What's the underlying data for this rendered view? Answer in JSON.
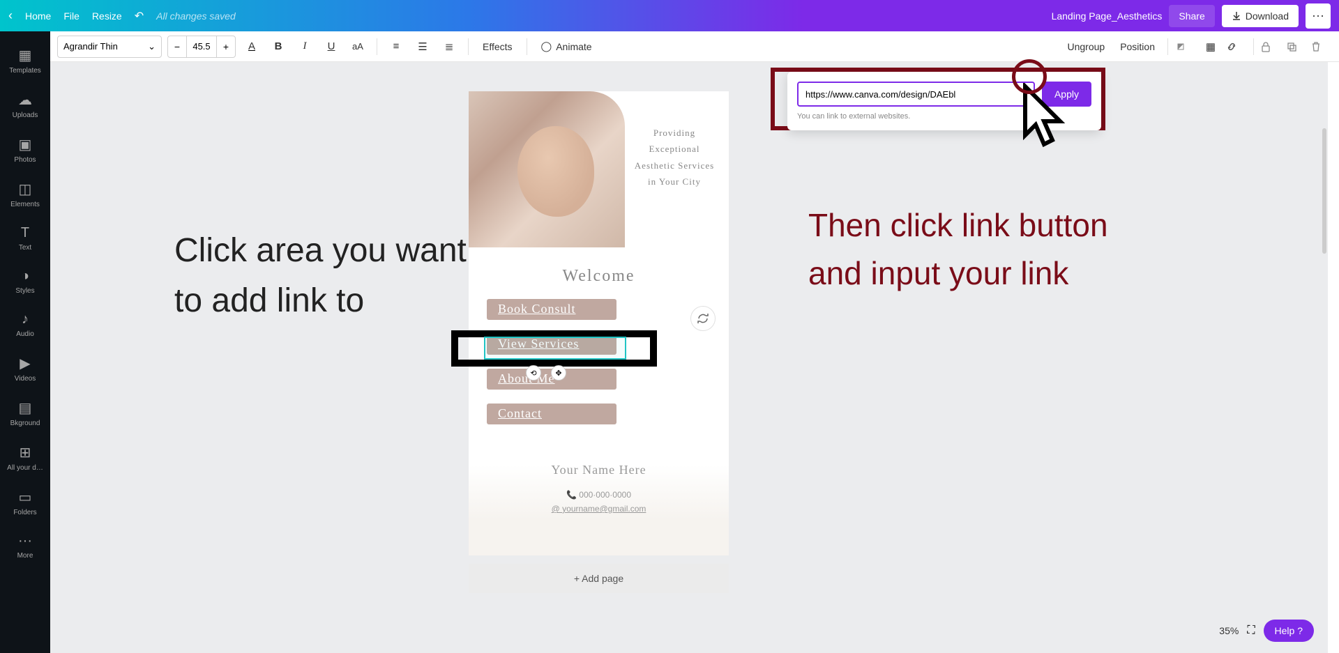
{
  "topbar": {
    "home": "Home",
    "file": "File",
    "resize": "Resize",
    "saved": "All changes saved",
    "docname": "Landing Page_Aesthetics",
    "share": "Share",
    "download": "Download"
  },
  "sidebar": {
    "items": [
      {
        "label": "Templates",
        "icon": "templates-icon"
      },
      {
        "label": "Uploads",
        "icon": "uploads-icon"
      },
      {
        "label": "Photos",
        "icon": "photos-icon"
      },
      {
        "label": "Elements",
        "icon": "elements-icon"
      },
      {
        "label": "Text",
        "icon": "text-icon"
      },
      {
        "label": "Styles",
        "icon": "styles-icon"
      },
      {
        "label": "Audio",
        "icon": "audio-icon"
      },
      {
        "label": "Videos",
        "icon": "videos-icon"
      },
      {
        "label": "Bkground",
        "icon": "background-icon"
      },
      {
        "label": "All your d…",
        "icon": "designs-icon"
      },
      {
        "label": "Folders",
        "icon": "folders-icon"
      },
      {
        "label": "More",
        "icon": "more-icon"
      }
    ]
  },
  "ctx": {
    "font": "Agrandir Thin",
    "size": "45.5",
    "effects": "Effects",
    "animate": "Animate",
    "ungroup": "Ungroup",
    "position": "Position"
  },
  "design": {
    "tagline": "Providing Exceptional Aesthetic Services in Your City",
    "welcome": "Welcome",
    "links": [
      "Book Consult",
      "View Services",
      "About Me",
      "Contact"
    ],
    "your_name": "Your Name Here",
    "phone": "000·000·0000",
    "email": "yourname@gmail.com"
  },
  "addpage": "+ Add page",
  "popover": {
    "url": "https://www.canva.com/design/DAEbl",
    "apply": "Apply",
    "hint": "You can link to external websites."
  },
  "annotations": {
    "left": "Click area you want to add link to",
    "right": "Then click link button and input your link"
  },
  "zoom": "35%",
  "help": "Help ?"
}
